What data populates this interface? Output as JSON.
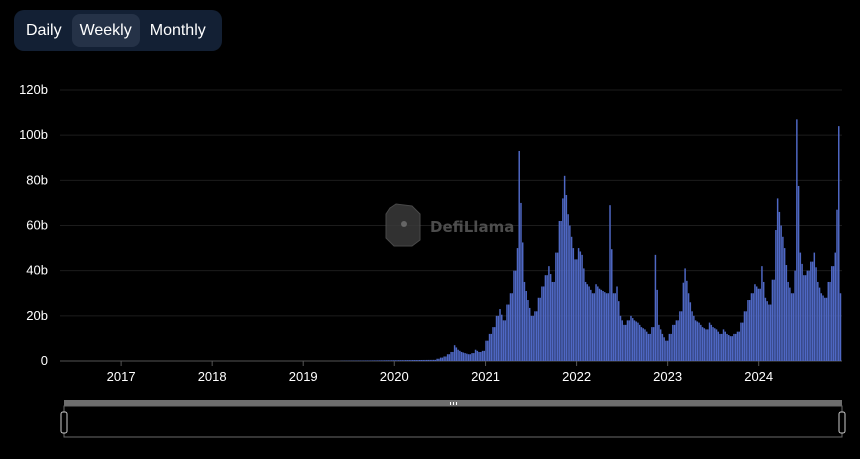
{
  "toggle": {
    "options": [
      "Daily",
      "Weekly",
      "Monthly"
    ],
    "selected": "Weekly"
  },
  "watermark": {
    "text": "DefiLlama"
  },
  "colors": {
    "bar": "#4f68c4",
    "toggle_bg": "#132034",
    "toggle_active": "#253247",
    "grid": "#1c1c1c"
  },
  "chart_data": {
    "type": "bar",
    "x_ticks": [
      "2017",
      "2018",
      "2019",
      "2020",
      "2021",
      "2022",
      "2023",
      "2024"
    ],
    "y_ticks": [
      "0",
      "20b",
      "40b",
      "60b",
      "80b",
      "100b",
      "120b"
    ],
    "ylim": [
      0,
      120
    ],
    "y_unit": "b",
    "xlim": [
      "2016-05-01",
      "2024-11-30"
    ],
    "grid": "horizontal",
    "series": [
      {
        "points": [
          [
            "2020-06-07",
            0.5
          ],
          [
            "2020-06-21",
            1
          ],
          [
            "2020-07-05",
            1.5
          ],
          [
            "2020-07-19",
            2
          ],
          [
            "2020-08-02",
            3
          ],
          [
            "2020-08-16",
            4
          ],
          [
            "2020-08-30",
            7
          ],
          [
            "2020-09-13",
            5
          ],
          [
            "2020-09-27",
            4
          ],
          [
            "2020-10-11",
            3.5
          ],
          [
            "2020-10-25",
            3
          ],
          [
            "2020-11-08",
            3.5
          ],
          [
            "2020-11-22",
            5
          ],
          [
            "2020-12-06",
            4
          ],
          [
            "2020-12-20",
            4.5
          ],
          [
            "2021-01-03",
            9
          ],
          [
            "2021-01-17",
            12
          ],
          [
            "2021-01-31",
            15
          ],
          [
            "2021-02-14",
            20
          ],
          [
            "2021-02-28",
            23
          ],
          [
            "2021-03-14",
            18
          ],
          [
            "2021-03-28",
            25
          ],
          [
            "2021-04-11",
            30
          ],
          [
            "2021-04-25",
            40
          ],
          [
            "2021-05-09",
            50
          ],
          [
            "2021-05-16",
            93
          ],
          [
            "2021-05-23",
            70
          ],
          [
            "2021-06-06",
            35
          ],
          [
            "2021-06-20",
            27
          ],
          [
            "2021-07-04",
            20
          ],
          [
            "2021-07-18",
            22
          ],
          [
            "2021-08-01",
            28
          ],
          [
            "2021-08-15",
            33
          ],
          [
            "2021-08-29",
            38
          ],
          [
            "2021-09-12",
            42
          ],
          [
            "2021-09-26",
            35
          ],
          [
            "2021-10-10",
            48
          ],
          [
            "2021-10-24",
            62
          ],
          [
            "2021-11-07",
            72
          ],
          [
            "2021-11-14",
            82
          ],
          [
            "2021-11-28",
            65
          ],
          [
            "2021-12-12",
            55
          ],
          [
            "2021-12-26",
            45
          ],
          [
            "2022-01-09",
            50
          ],
          [
            "2022-01-23",
            47
          ],
          [
            "2022-02-06",
            35
          ],
          [
            "2022-02-20",
            33
          ],
          [
            "2022-03-06",
            30
          ],
          [
            "2022-03-20",
            34
          ],
          [
            "2022-04-03",
            32
          ],
          [
            "2022-04-17",
            31
          ],
          [
            "2022-05-01",
            30
          ],
          [
            "2022-05-15",
            69
          ],
          [
            "2022-05-29",
            30
          ],
          [
            "2022-06-12",
            33
          ],
          [
            "2022-06-26",
            20
          ],
          [
            "2022-07-10",
            16
          ],
          [
            "2022-07-24",
            18
          ],
          [
            "2022-08-07",
            20
          ],
          [
            "2022-08-21",
            18
          ],
          [
            "2022-09-04",
            17
          ],
          [
            "2022-09-18",
            15
          ],
          [
            "2022-10-02",
            14
          ],
          [
            "2022-10-16",
            12
          ],
          [
            "2022-10-30",
            15
          ],
          [
            "2022-11-13",
            47
          ],
          [
            "2022-11-27",
            16
          ],
          [
            "2022-12-11",
            12
          ],
          [
            "2022-12-25",
            9
          ],
          [
            "2023-01-08",
            12
          ],
          [
            "2023-01-22",
            16
          ],
          [
            "2023-02-05",
            18
          ],
          [
            "2023-02-19",
            22
          ],
          [
            "2023-03-12",
            41
          ],
          [
            "2023-03-26",
            30
          ],
          [
            "2023-04-09",
            22
          ],
          [
            "2023-04-23",
            18
          ],
          [
            "2023-05-07",
            17
          ],
          [
            "2023-05-21",
            15
          ],
          [
            "2023-06-04",
            14
          ],
          [
            "2023-06-18",
            17
          ],
          [
            "2023-07-02",
            15
          ],
          [
            "2023-07-16",
            14
          ],
          [
            "2023-07-30",
            12
          ],
          [
            "2023-08-13",
            14
          ],
          [
            "2023-08-27",
            12
          ],
          [
            "2023-09-10",
            11
          ],
          [
            "2023-09-24",
            12
          ],
          [
            "2023-10-08",
            13
          ],
          [
            "2023-10-22",
            17
          ],
          [
            "2023-11-05",
            22
          ],
          [
            "2023-11-19",
            27
          ],
          [
            "2023-12-03",
            30
          ],
          [
            "2023-12-17",
            34
          ],
          [
            "2023-12-31",
            32
          ],
          [
            "2024-01-14",
            42
          ],
          [
            "2024-01-28",
            28
          ],
          [
            "2024-02-11",
            25
          ],
          [
            "2024-02-25",
            36
          ],
          [
            "2024-03-10",
            58
          ],
          [
            "2024-03-17",
            72
          ],
          [
            "2024-03-31",
            60
          ],
          [
            "2024-04-14",
            50
          ],
          [
            "2024-04-28",
            35
          ],
          [
            "2024-05-12",
            30
          ],
          [
            "2024-05-26",
            40
          ],
          [
            "2024-06-02",
            107
          ],
          [
            "2024-06-16",
            48
          ],
          [
            "2024-06-30",
            38
          ],
          [
            "2024-07-14",
            40
          ],
          [
            "2024-07-28",
            44
          ],
          [
            "2024-08-11",
            48
          ],
          [
            "2024-08-25",
            35
          ],
          [
            "2024-09-08",
            30
          ],
          [
            "2024-09-22",
            28
          ],
          [
            "2024-10-06",
            35
          ],
          [
            "2024-10-20",
            42
          ],
          [
            "2024-11-03",
            48
          ],
          [
            "2024-11-10",
            67
          ],
          [
            "2024-11-17",
            104
          ],
          [
            "2024-11-24",
            30
          ]
        ]
      }
    ]
  }
}
